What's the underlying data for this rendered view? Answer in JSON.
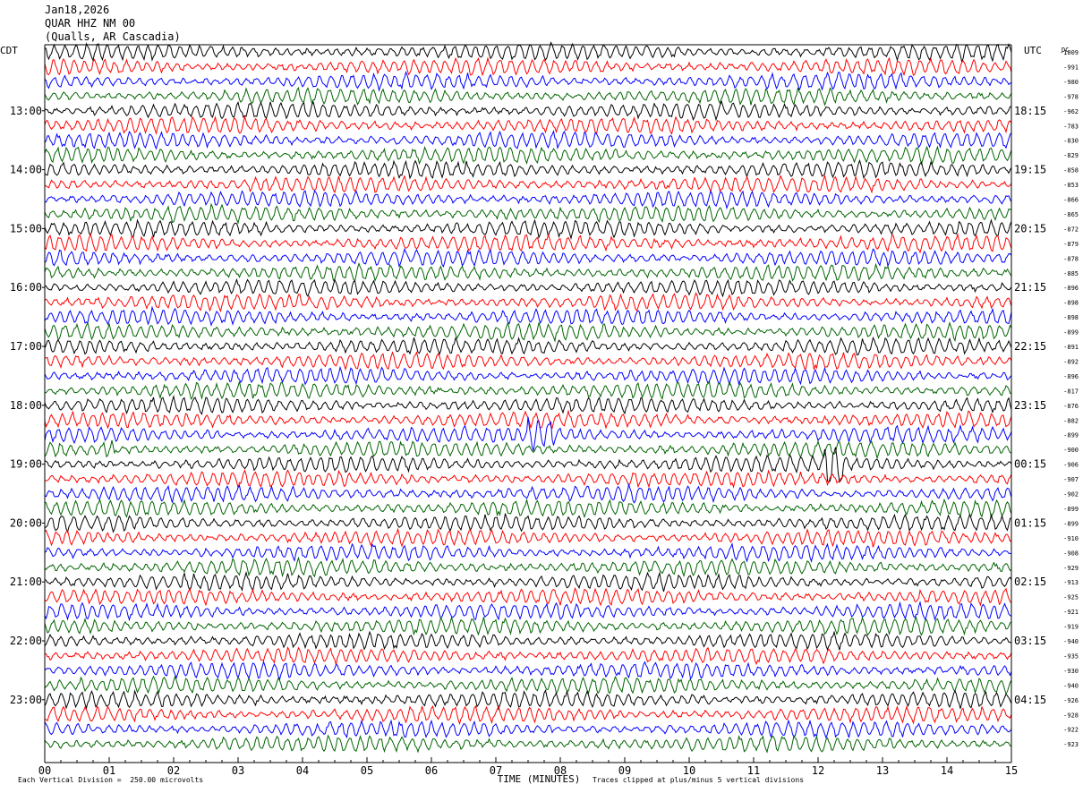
{
  "header": {
    "date": "Jan18,2026",
    "station": "QUAR HHZ NM 00",
    "location": "(Qualls, AR Cascadia)"
  },
  "footer": {
    "scale_note": "Each Vertical Division =  250.00 microvolts",
    "clip_note": "Traces clipped at plus/minus 5 vertical divisions"
  },
  "chart_data": {
    "type": "line",
    "title": "",
    "xlabel": "TIME (MINUTES)",
    "ylabel": "",
    "left_axis_label": "CDT",
    "right_axis_label": "UTC",
    "dc_label": "DC",
    "xlim": [
      0,
      15
    ],
    "x_ticks": [
      "00",
      "01",
      "02",
      "03",
      "04",
      "05",
      "06",
      "07",
      "08",
      "09",
      "10",
      "11",
      "12",
      "13",
      "14",
      "15"
    ],
    "left_hour_labels": [
      "13:00",
      "14:00",
      "15:00",
      "16:00",
      "17:00",
      "18:00",
      "19:00",
      "20:00",
      "21:00",
      "22:00",
      "23:00"
    ],
    "right_hour_labels": [
      "18:15",
      "19:15",
      "20:15",
      "21:15",
      "22:15",
      "23:15",
      "00:15",
      "01:15",
      "02:15",
      "03:15",
      "04:15"
    ],
    "trace_colors": [
      "#000000",
      "#ff0000",
      "#0000ff",
      "#006400"
    ],
    "dc_offsets": [
      -1009,
      -991,
      -980,
      -978,
      -962,
      -783,
      -830,
      -829,
      -858,
      -853,
      -866,
      -865,
      -872,
      -879,
      -878,
      -885,
      -896,
      -898,
      -898,
      -899,
      -891,
      -892,
      -896,
      -817,
      -876,
      -882,
      -899,
      -900,
      -906,
      -907,
      -902,
      -899,
      -899,
      -910,
      -908,
      -929,
      -913,
      -925,
      -921,
      -919,
      -940,
      -935,
      -930,
      -940,
      -926,
      -928,
      -922,
      -923
    ],
    "events": [
      {
        "trace_index": 26,
        "minute_start": 7.5,
        "minute_end": 7.9,
        "note": "burst"
      },
      {
        "trace_index": 27,
        "minute_start": 0.9,
        "minute_end": 1.1,
        "note": "burst"
      },
      {
        "trace_index": 28,
        "minute_start": 12.1,
        "minute_end": 12.4,
        "note": "clipped burst"
      }
    ]
  }
}
